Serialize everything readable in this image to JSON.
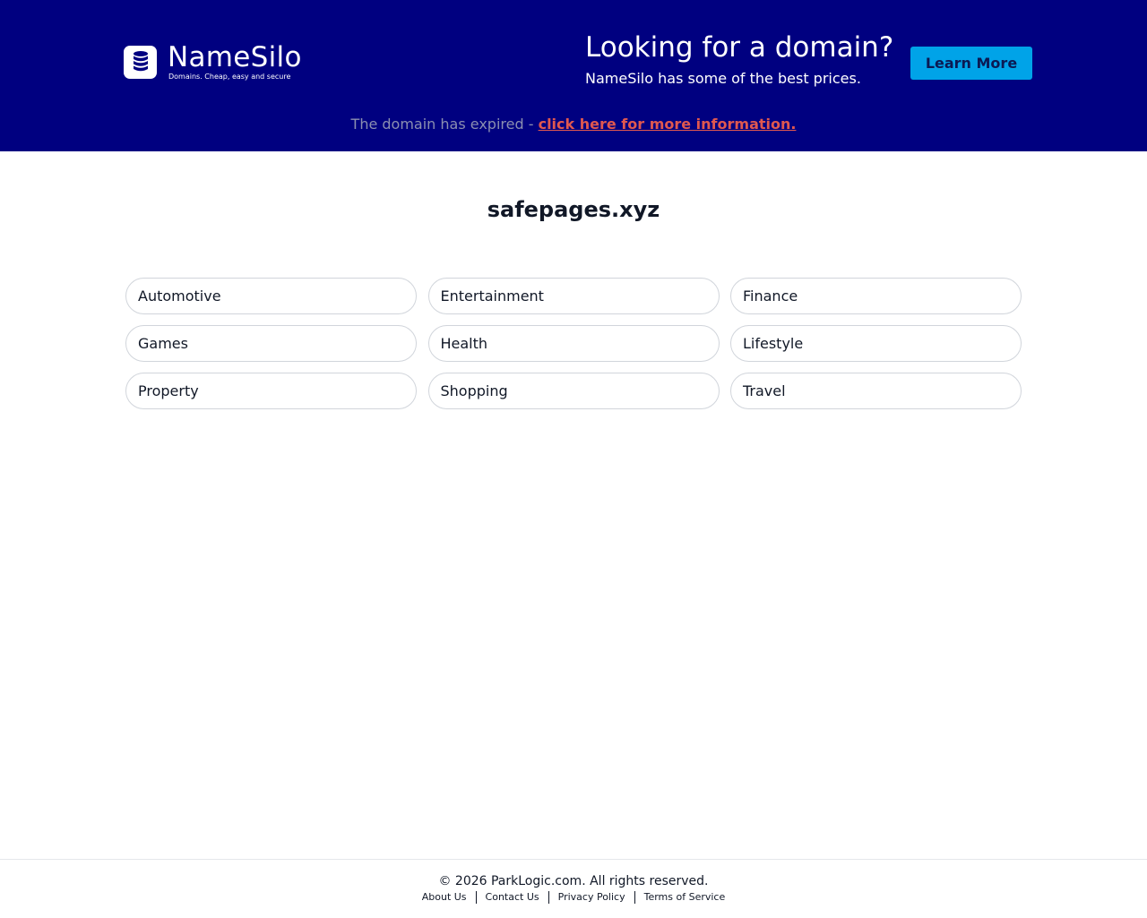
{
  "header": {
    "logo_name": "NameSilo",
    "logo_tagline": "Domains. Cheap, easy and secure",
    "promo_title": "Looking for a domain?",
    "promo_subtitle": "NameSilo has some of the best prices.",
    "cta_label": "Learn More",
    "expired_text": "The domain has expired - ",
    "expired_link": "click here for more information."
  },
  "main": {
    "domain": "safepages.xyz",
    "categories": [
      "Automotive",
      "Entertainment",
      "Finance",
      "Games",
      "Health",
      "Lifestyle",
      "Property",
      "Shopping",
      "Travel"
    ]
  },
  "footer": {
    "copyright": "© 2026 ParkLogic.com. All rights reserved.",
    "links": [
      "About Us",
      "Contact Us",
      "Privacy Policy",
      "Terms of Service"
    ]
  },
  "colors": {
    "banner_bg": "#000080",
    "cta_bg": "#00a3e8",
    "link_red": "#e0584f"
  }
}
